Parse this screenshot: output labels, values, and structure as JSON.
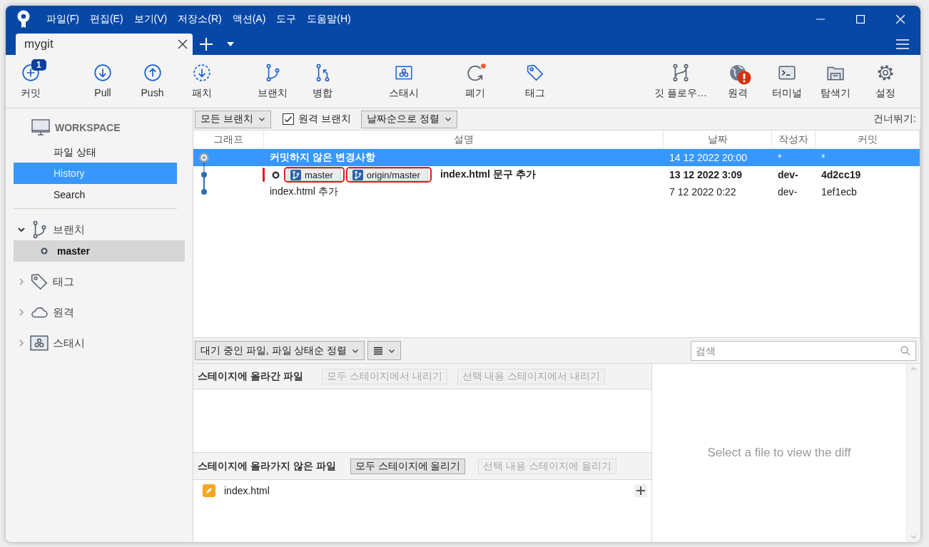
{
  "menu": [
    "파일(F)",
    "편집(E)",
    "보기(V)",
    "저장소(R)",
    "액션(A)",
    "도구",
    "도움말(H)"
  ],
  "tabs": [
    {
      "label": "mygit",
      "selected": true
    }
  ],
  "toolbar": {
    "left": [
      {
        "label": "커밋",
        "badge": "1"
      },
      {
        "label": "Pull"
      },
      {
        "label": "Push"
      },
      {
        "label": "패치"
      },
      {
        "label": "브랜치"
      },
      {
        "label": "병합"
      },
      {
        "label": "스태시"
      },
      {
        "label": "폐기",
        "indicator": true
      },
      {
        "label": "태그"
      }
    ],
    "right": [
      {
        "label": "깃 플로우…"
      },
      {
        "label": "원격",
        "alert": true
      },
      {
        "label": "터미널"
      },
      {
        "label": "탐색기"
      },
      {
        "label": "설정"
      }
    ]
  },
  "sidebar": {
    "workspace": "WORKSPACE",
    "items": [
      {
        "label": "파일 상태",
        "selected": false
      },
      {
        "label": "History",
        "selected": true
      },
      {
        "label": "Search",
        "selected": false
      }
    ],
    "groups": [
      {
        "label": "브랜치",
        "expanded": true,
        "children": [
          {
            "label": "master",
            "selected": true
          }
        ]
      },
      {
        "label": "태그",
        "expanded": false
      },
      {
        "label": "원격",
        "expanded": false
      },
      {
        "label": "스태시",
        "expanded": false
      }
    ]
  },
  "history": {
    "branch_filter": "모든 브랜치",
    "remote_branches": {
      "label": "원격 브랜치",
      "checked": true
    },
    "sort": "날짜순으로 정렬",
    "jump": "건너뛰기:",
    "columns": [
      "그래프",
      "설명",
      "날짜",
      "작성자",
      "커밋"
    ],
    "rows": [
      {
        "kind": "uncommitted",
        "selected": true,
        "description": "커밋하지 않은 변경사항",
        "date": "14 12 2022 20:00",
        "author": "*",
        "commit": "*"
      },
      {
        "kind": "head",
        "selected": false,
        "refs": [
          "master",
          "origin/master"
        ],
        "description": "index.html 문구 추가",
        "date": "13 12 2022 3:09",
        "author": "dev-",
        "commit": "4d2cc19"
      },
      {
        "kind": "commit",
        "selected": false,
        "description": "index.html 추가",
        "date": "7 12 2022 0:22",
        "author": "dev-",
        "commit": "1ef1ecb"
      }
    ]
  },
  "staging": {
    "file_sort": "대기 중인 파일, 파일 상태순 정렬",
    "search": {
      "placeholder": "검색"
    },
    "staged": {
      "title": "스테이지에 올라간 파일",
      "buttons": [
        {
          "label": "모두 스테이지에서 내리기",
          "disabled": true
        },
        {
          "label": "선택 내용 스테이지에서 내리기",
          "disabled": true
        }
      ]
    },
    "unstaged": {
      "title": "스테이지에 올라가지 않은 파일",
      "buttons": [
        {
          "label": "모두 스테이지에 올리기",
          "disabled": false
        },
        {
          "label": "선택 내용 스테이지에 올리기",
          "disabled": true
        }
      ],
      "files": [
        {
          "name": "index.html"
        }
      ]
    },
    "diff_placeholder": "Select a file to view the diff"
  }
}
